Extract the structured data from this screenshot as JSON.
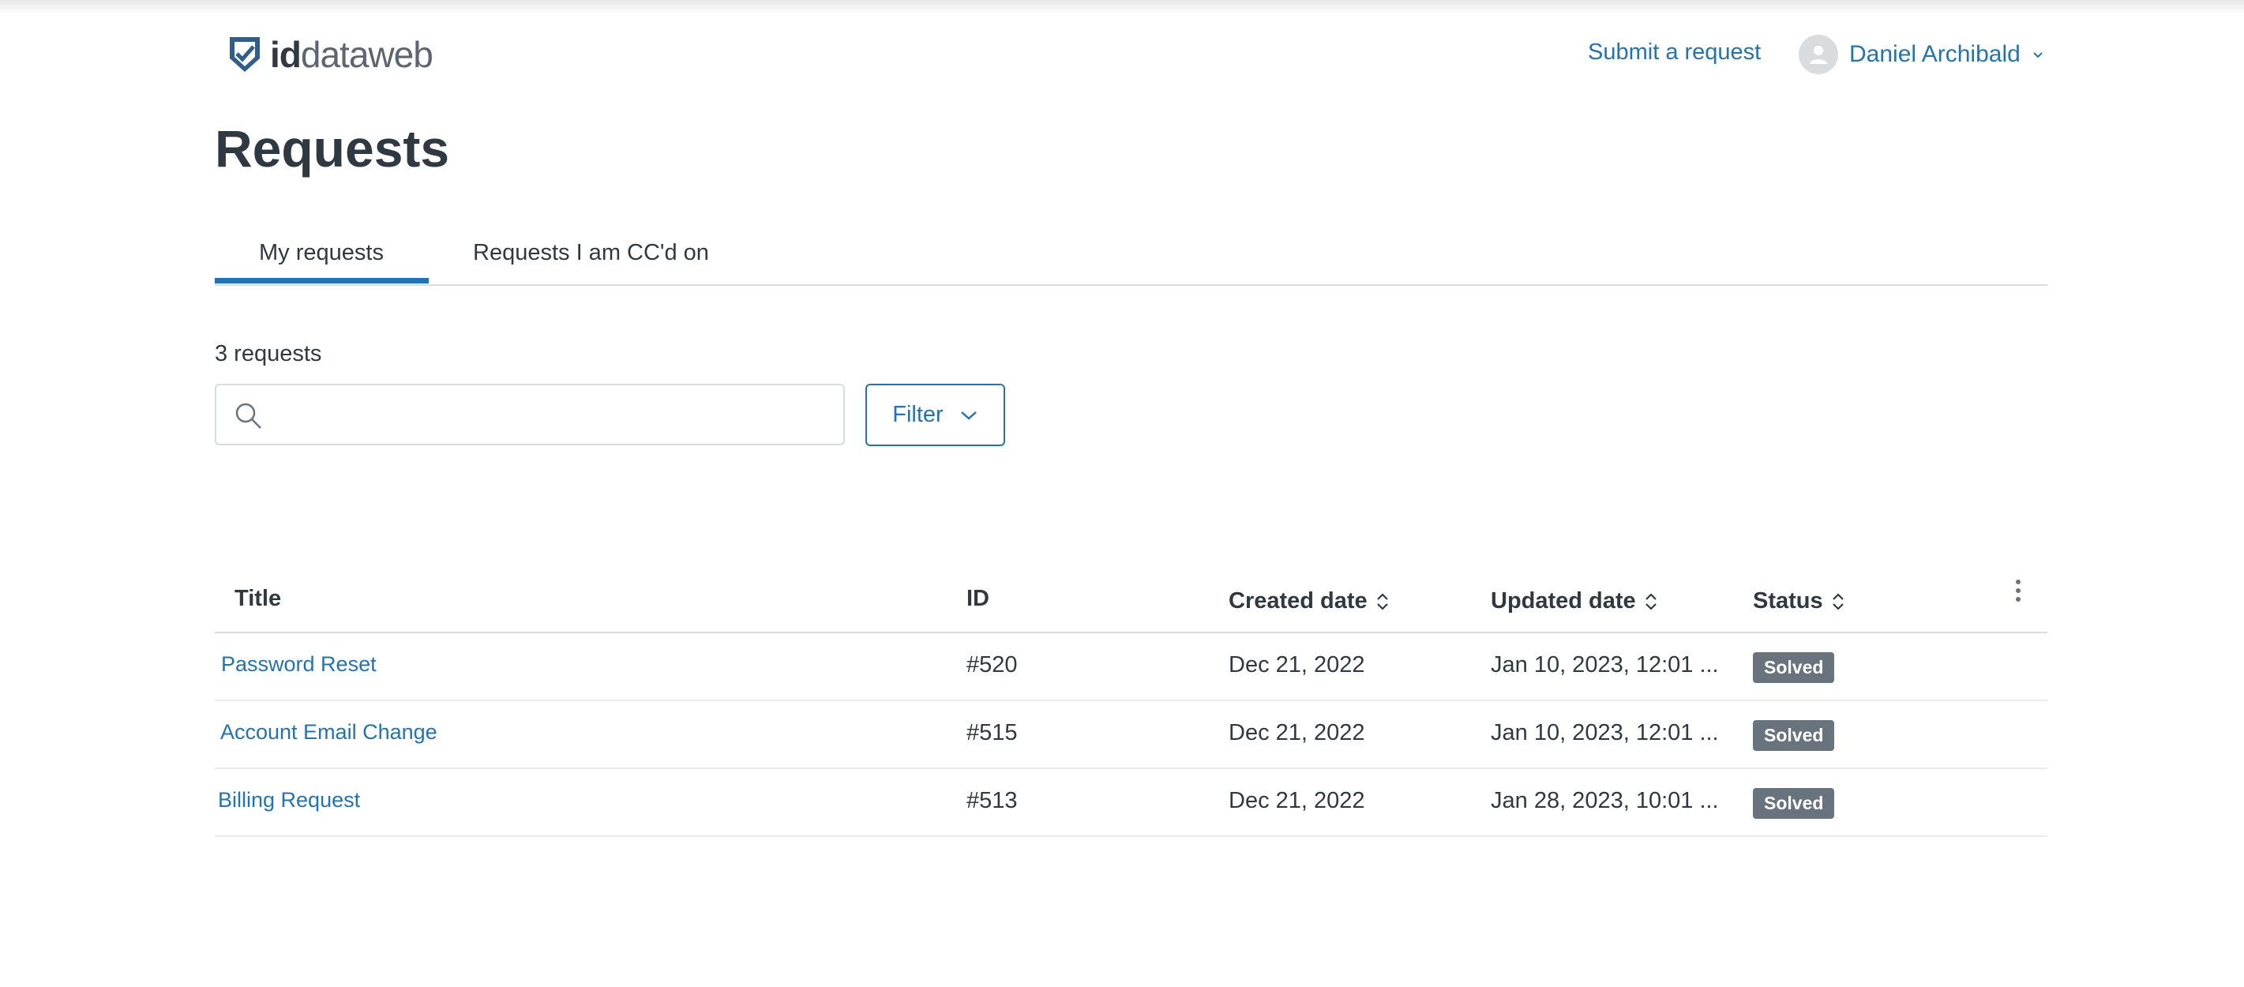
{
  "header": {
    "logo_bold": "id",
    "logo_light": "dataweb",
    "submit_request": "Submit a request",
    "user_name": "Daniel Archibald"
  },
  "page": {
    "title": "Requests",
    "tabs": [
      {
        "label": "My requests",
        "active": true
      },
      {
        "label": "Requests I am CC'd on",
        "active": false
      }
    ],
    "count_text": "3 requests",
    "search": {
      "value": "",
      "placeholder": ""
    },
    "filter_label": "Filter"
  },
  "table": {
    "columns": {
      "title": "Title",
      "id": "ID",
      "created": "Created date",
      "updated": "Updated date",
      "status": "Status"
    },
    "rows": [
      {
        "title": "Password Reset",
        "id": "#520",
        "created": "Dec 21, 2022",
        "updated": "Jan 10, 2023, 12:01 ...",
        "status": "Solved"
      },
      {
        "title": "Account Email Change",
        "id": "#515",
        "created": "Dec 21, 2022",
        "updated": "Jan 10, 2023, 12:01 ...",
        "status": "Solved"
      },
      {
        "title": "Billing Request",
        "id": "#513",
        "created": "Dec 21, 2022",
        "updated": "Jan 28, 2023, 10:01 ...",
        "status": "Solved"
      }
    ]
  },
  "colors": {
    "accent": "#1f73b7",
    "badge": "#68737d",
    "text": "#2f3941",
    "border": "#d8dcde"
  },
  "icons": [
    "shield-logo-icon",
    "user-avatar-icon",
    "chevron-down-icon",
    "search-icon",
    "sort-icon",
    "more-vertical-icon"
  ]
}
